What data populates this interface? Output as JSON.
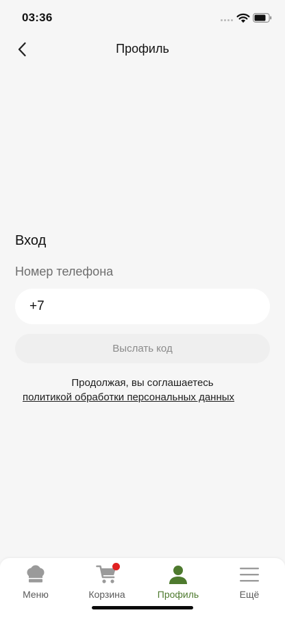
{
  "status": {
    "time": "03:36"
  },
  "header": {
    "title": "Профиль"
  },
  "login": {
    "heading": "Вход",
    "phone_label": "Номер телефона",
    "phone_value": "+7",
    "send_code_label": "Выслать код",
    "consent_text": "Продолжая, вы соглашаетесь",
    "privacy_link": "политикой обработки персональных данных"
  },
  "tabs": [
    {
      "label": "Меню",
      "icon": "chef-hat-icon",
      "active": false
    },
    {
      "label": "Корзина",
      "icon": "cart-icon",
      "active": false,
      "badge": true
    },
    {
      "label": "Профиль",
      "icon": "user-icon",
      "active": true
    },
    {
      "label": "Ещё",
      "icon": "hamburger-menu-icon",
      "active": false
    }
  ],
  "colors": {
    "background": "#f6f6f6",
    "accent": "#4e7a2e",
    "badge": "#e02020",
    "inactive_icon": "#9a9a9a"
  }
}
